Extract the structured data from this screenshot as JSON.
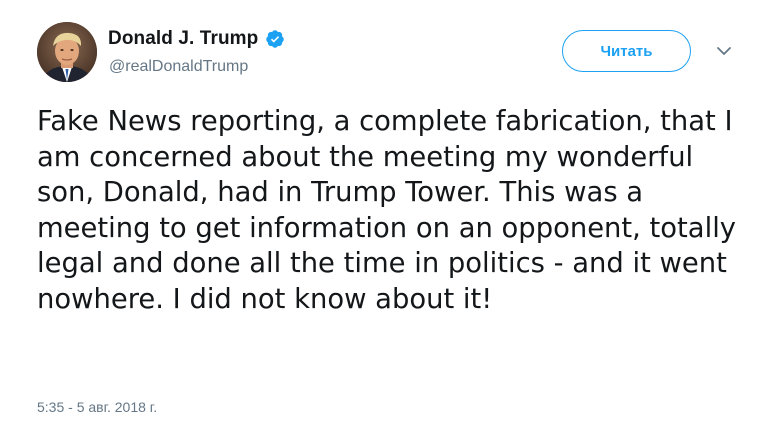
{
  "author": {
    "display_name": "Donald J. Trump",
    "handle": "@realDonaldTrump",
    "verified": true
  },
  "actions": {
    "follow_label": "Читать"
  },
  "tweet": {
    "text": "Fake News reporting, a complete fabrication, that I am concerned about the meeting my wonderful son, Donald, had in Trump Tower. This was a meeting to get information on an opponent, totally legal and done all the time in politics - and it went nowhere. I did not know about it!",
    "timestamp": "5:35 - 5 авг. 2018 г."
  },
  "icons": {
    "verified": "verified-badge-icon",
    "more": "chevron-down-icon",
    "avatar": "avatar"
  },
  "colors": {
    "accent": "#1da1f2",
    "text": "#14171a",
    "muted": "#657786"
  }
}
